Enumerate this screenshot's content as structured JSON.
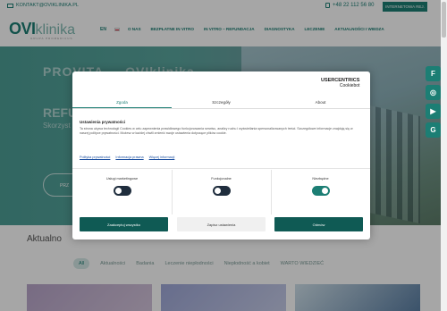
{
  "topbar": {
    "email": "KONTAKT@OVIKLINIKA.PL",
    "phone": "+48 22 112 56 80",
    "cta": "INTERNETOWA REJ."
  },
  "header": {
    "logo_main": "OVI",
    "logo_sub": "klinika",
    "logo_tag": "GRUPA PROMEDICUS",
    "lang": "EN",
    "nav": [
      "O NAS",
      "BEZPŁATNE IN VITRO",
      "IN VITRO – REFUNDACJA",
      "DIAGNOSTYKA",
      "LECZENIE",
      "AKTUALNOŚCI I WIEDZA"
    ]
  },
  "hero": {
    "title1": "PROVITA ... OVIklinika",
    "title2": "REFU",
    "subtitle": "Skorzyst",
    "button": "PRZ"
  },
  "side_icons": [
    "F",
    "◎",
    "▶",
    "G"
  ],
  "news": {
    "title": "Aktualno",
    "filters": [
      "All",
      "Aktualności",
      "Badania",
      "Leczenie niepłodności",
      "Niepłodność a kobiet",
      "WARTO WIEDZIEĆ"
    ]
  },
  "dialog": {
    "brand": "USERCENTRICS",
    "brand_sub": "Cookiebot",
    "tabs": [
      "Zgoda",
      "Szczegóły",
      "About"
    ],
    "heading": "Ustawienia prywatności",
    "body": "Ta strona używa technologii Cookies w celu zapewnienia prawidłowego funkcjonowania serwisu, analizy ruchu i wyświetlania spersonalizowanych treści. Szczegółowe informacje znajdują się w naszej polityce prywatności. Możesz w każdej chwili zmienić swoje ustawienia dotyczące plików cookie.",
    "links": [
      "Polityka prywatności",
      "Informacja prawna",
      "Więcej informacji"
    ],
    "toggles": [
      {
        "label": "Usługi marketingowe",
        "on": false
      },
      {
        "label": "Funkcjonalne",
        "on": false
      },
      {
        "label": "Niezbędne",
        "on": true
      }
    ],
    "buttons": [
      "Zaakceptuj wszystko",
      "Zapisz ustawienia",
      "Odmów"
    ]
  },
  "colors": {
    "accent": "#1c7e74",
    "dark_button": "#0f5a54"
  }
}
